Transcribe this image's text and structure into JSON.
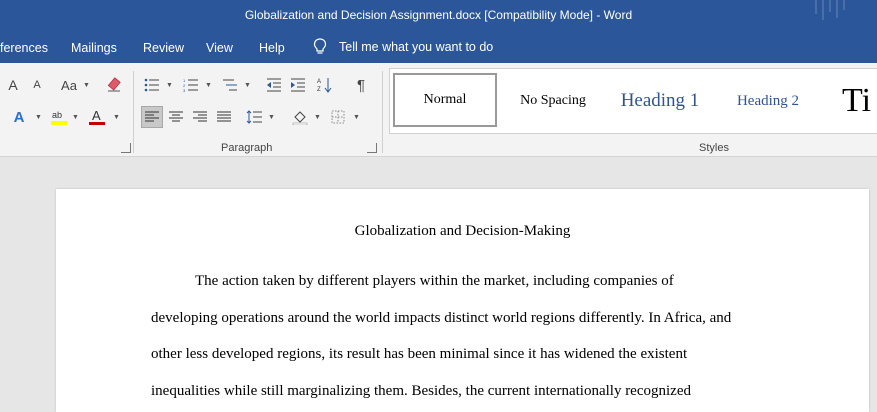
{
  "window": {
    "title": "Globalization and Decision Assignment.docx [Compatibility Mode]  -  Word"
  },
  "menu": {
    "items": [
      "ferences",
      "Mailings",
      "Review",
      "View",
      "Help"
    ],
    "tell_me": "Tell me what you want to do"
  },
  "ribbon": {
    "groups": {
      "paragraph": "Paragraph",
      "styles": "Styles"
    },
    "font_size_labels": {
      "grow": "A",
      "shrink": "A",
      "change_case": "Aa"
    },
    "styles": [
      {
        "label": "Normal"
      },
      {
        "label": "No Spacing"
      },
      {
        "label": "Heading 1",
        "color": "#2f5496"
      },
      {
        "label": "Heading 2",
        "color": "#2f5496"
      },
      {
        "label": "Ti"
      }
    ],
    "colors": {
      "highlight": "#ffff00",
      "font_color": "#c00000",
      "accent": "#2b579a"
    }
  },
  "document": {
    "title": "Globalization and Decision-Making",
    "lines": [
      "The action taken by different players within the market, including companies of",
      "developing operations around the world impacts distinct world regions differently. In Africa, and",
      "other less developed regions, its result has been minimal since it has widened the existent",
      "inequalities while still marginalizing them. Besides, the current internationally recognized"
    ]
  }
}
